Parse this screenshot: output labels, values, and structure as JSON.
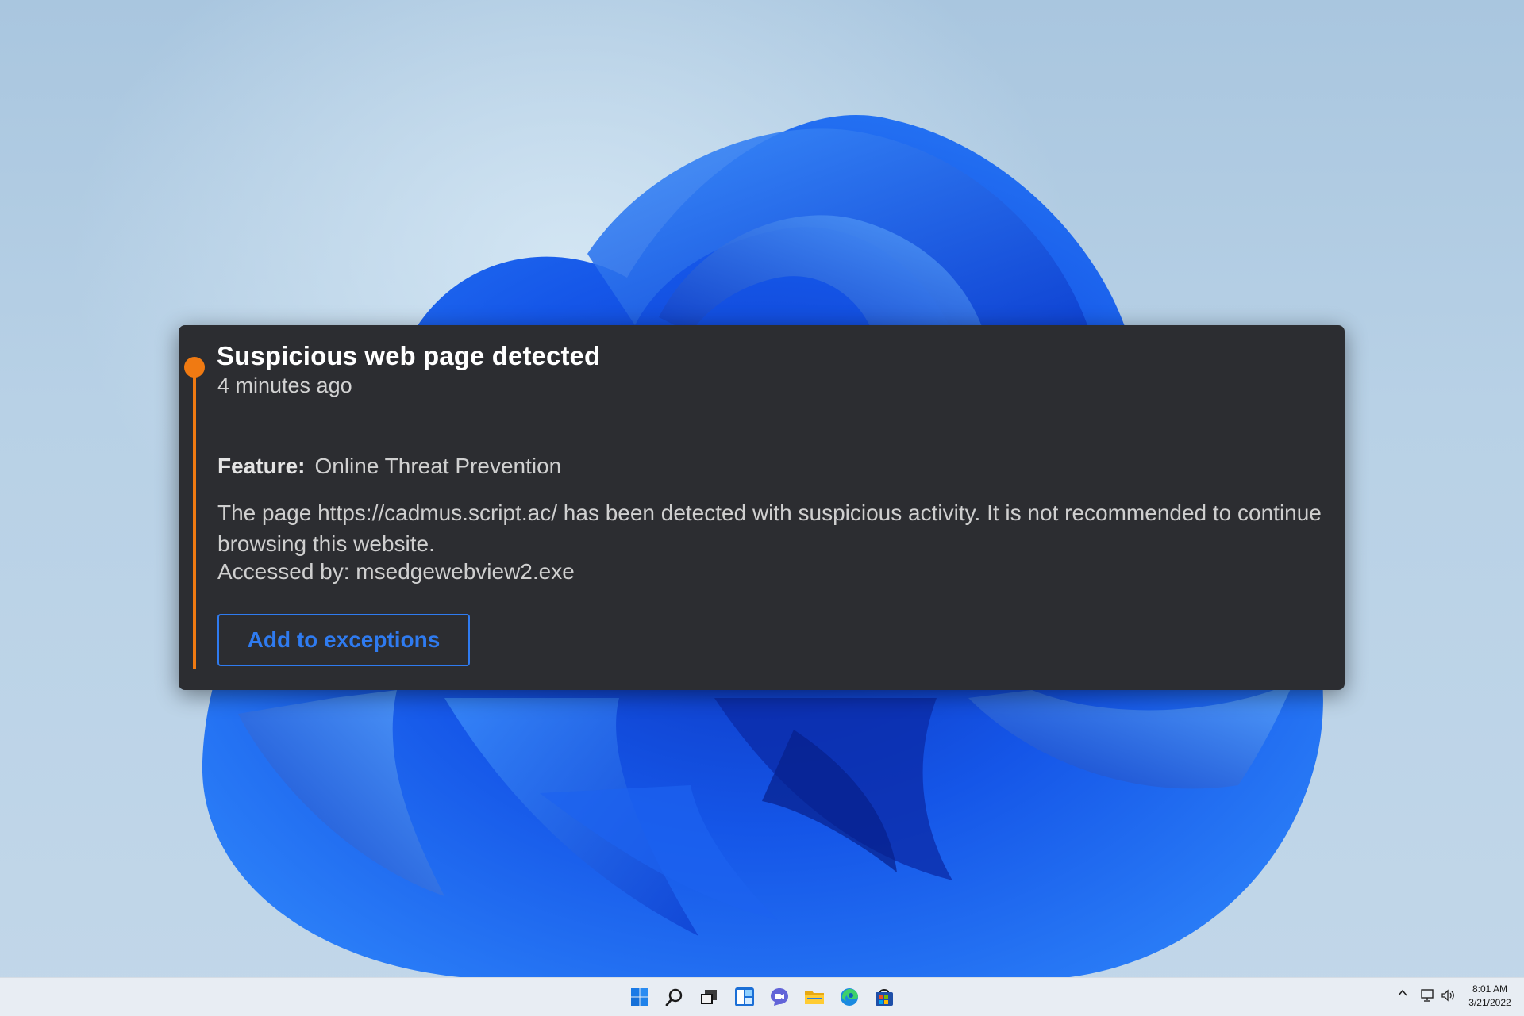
{
  "notification": {
    "title": "Suspicious web page detected",
    "time": "4 minutes ago",
    "feature_label": "Feature:",
    "feature_value": "Online Threat Prevention",
    "message": "The page https://cadmus.script.ac/ has been detected with suspicious activity. It is not recommended to continue browsing this website.",
    "accessed_by": "Accessed by: msedgewebview2.exe",
    "action_label": "Add to exceptions",
    "accent_color": "#f07a12",
    "action_color": "#2f7bf0"
  },
  "taskbar": {
    "icons": [
      "windows-start-icon",
      "search-icon",
      "task-view-icon",
      "widgets-icon",
      "teams-chat-icon",
      "file-explorer-icon",
      "edge-browser-icon",
      "microsoft-store-icon"
    ],
    "tray": {
      "icons": [
        "show-hidden-icons-chevron",
        "network-icon",
        "volume-icon"
      ],
      "time": "8:01 AM",
      "date": "3/21/2022"
    }
  }
}
